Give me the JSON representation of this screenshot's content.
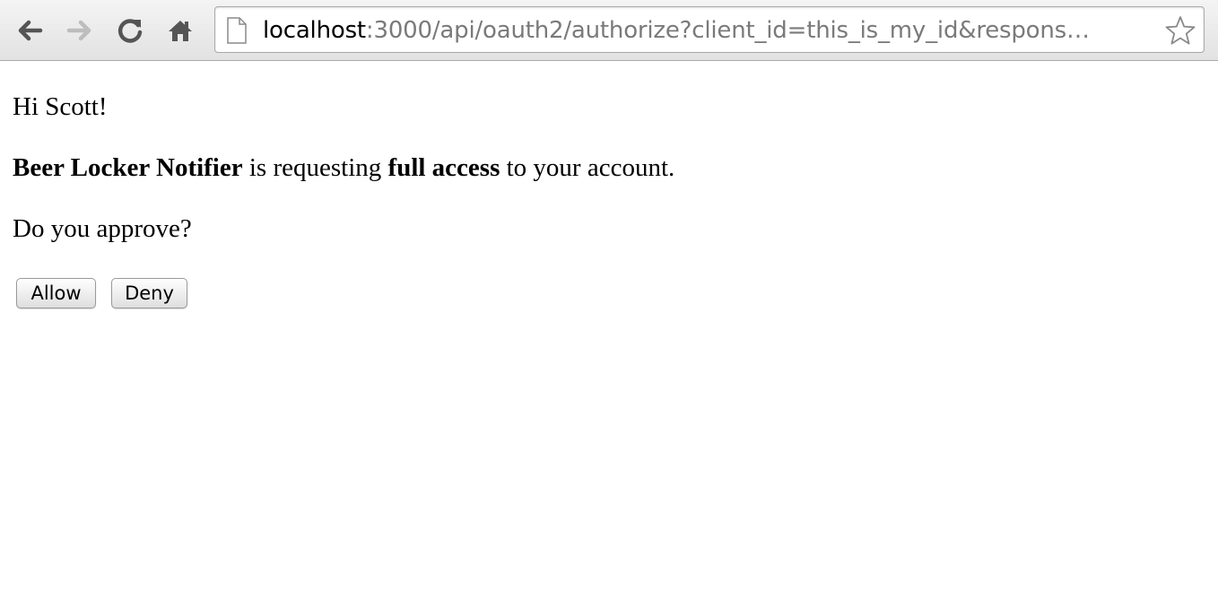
{
  "browser": {
    "url_host": "localhost",
    "url_rest": ":3000/api/oauth2/authorize?client_id=this_is_my_id&respons…",
    "icons": {
      "back": "back-arrow-icon",
      "forward": "forward-arrow-icon",
      "reload": "reload-icon",
      "home": "home-icon",
      "page": "page-document-icon",
      "bookmark": "star-icon"
    }
  },
  "page": {
    "greeting": "Hi Scott!",
    "app_name": "Beer Locker Notifier",
    "request_middle": " is requesting ",
    "access_level": "full access",
    "request_end": " to your account.",
    "question": "Do you approve?",
    "allow_label": "Allow",
    "deny_label": "Deny"
  }
}
